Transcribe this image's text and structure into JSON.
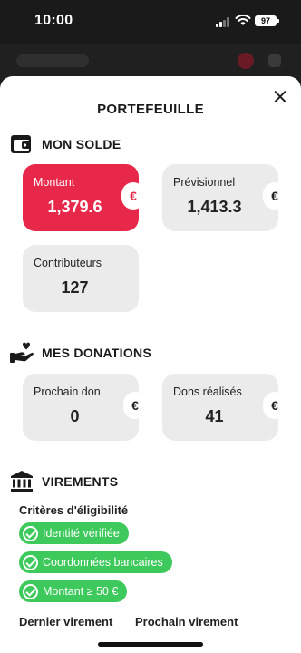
{
  "status_bar": {
    "time": "10:00",
    "battery": "97"
  },
  "sheet": {
    "title": "PORTEFEUILLE"
  },
  "solde": {
    "title": "MON SOLDE",
    "montant": {
      "label": "Montant",
      "value": "1,379.6",
      "currency": "€"
    },
    "previsionnel": {
      "label": "Prévisionnel",
      "value": "1,413.3",
      "currency": "€"
    },
    "contributeurs": {
      "label": "Contributeurs",
      "value": "127"
    }
  },
  "donations": {
    "title": "MES DONATIONS",
    "prochain": {
      "label": "Prochain don",
      "value": "0",
      "currency": "€"
    },
    "realises": {
      "label": "Dons réalisés",
      "value": "41",
      "currency": "€"
    }
  },
  "virements": {
    "title": "VIREMENTS",
    "criteria_title": "Critères d'éligibilité",
    "criteria": [
      "Identité vérifiée",
      "Coordonnées bancaires",
      "Montant ≥ 50 €"
    ],
    "dernier": "Dernier virement",
    "prochain": "Prochain virement"
  },
  "colors": {
    "accent": "#e8284a",
    "success": "#3ec95c",
    "card": "#ebebeb"
  },
  "icons": [
    "wallet-icon",
    "hand-heart-icon",
    "bank-icon",
    "close-icon",
    "check-icon"
  ]
}
